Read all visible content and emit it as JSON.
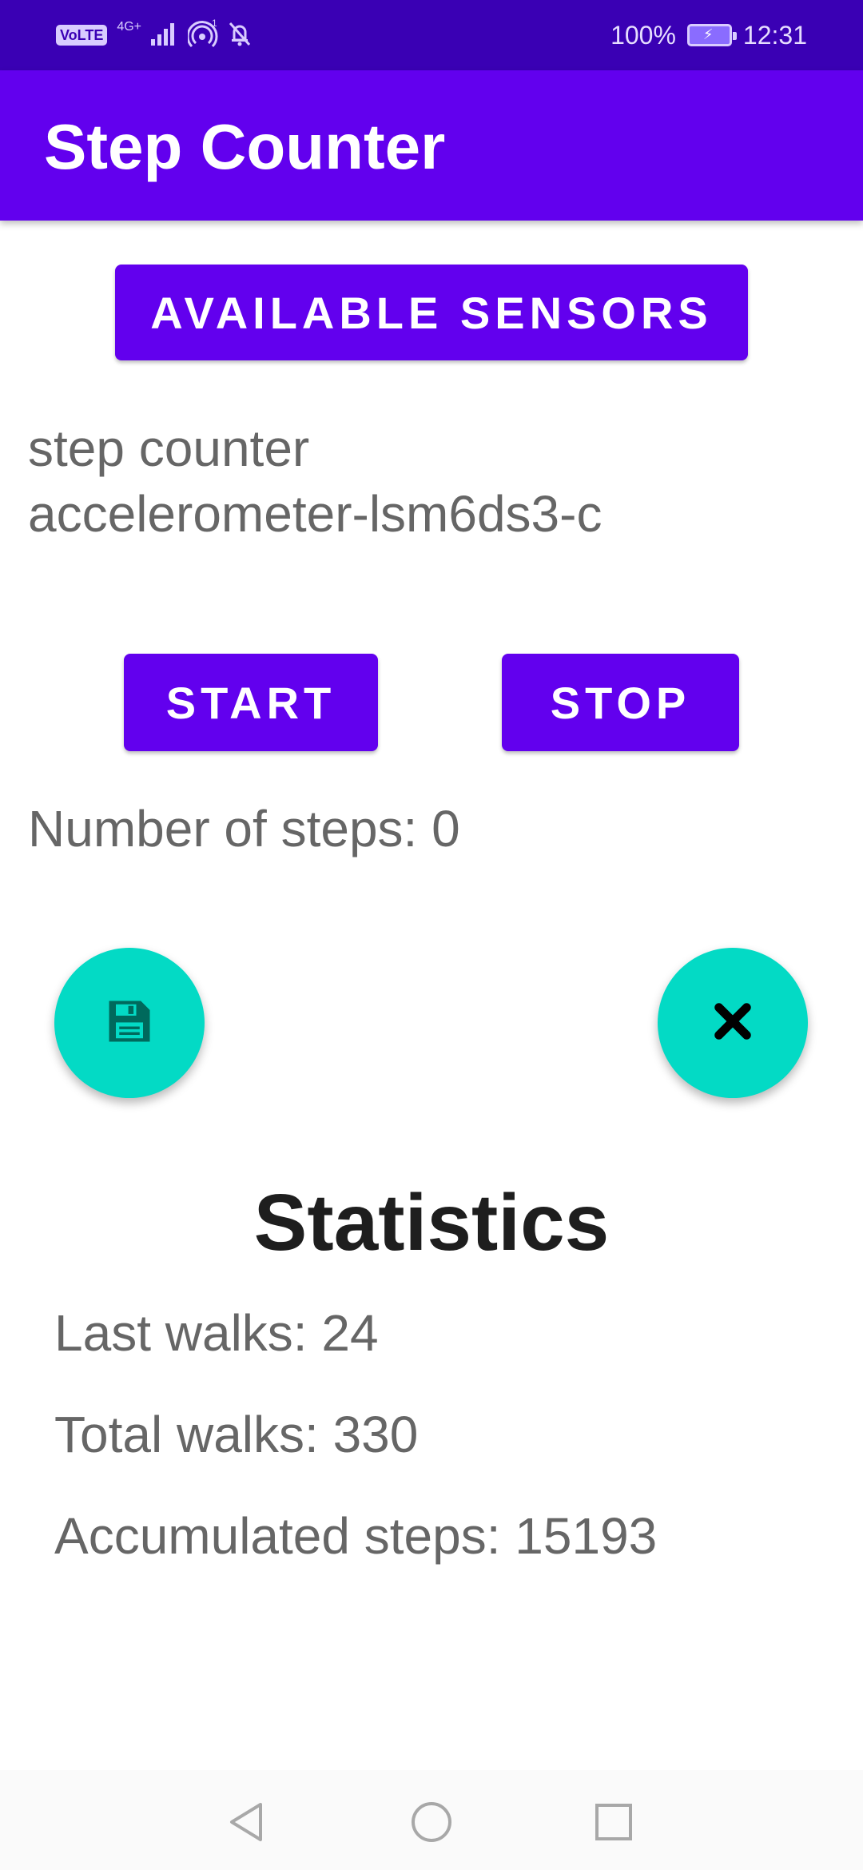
{
  "status_bar": {
    "volte": "VoLTE",
    "network": "4G+",
    "battery": "100%",
    "time": "12:31"
  },
  "app_bar": {
    "title": "Step Counter"
  },
  "buttons": {
    "available_sensors": "AVAILABLE SENSORS",
    "start": "START",
    "stop": "STOP"
  },
  "sensors": [
    "step counter",
    "accelerometer-lsm6ds3-c"
  ],
  "steps_text": "Number of steps: 0",
  "fabs": {
    "save_icon": "save-icon",
    "close_icon": "close-icon"
  },
  "statistics": {
    "title": "Statistics",
    "last_walks": "Last walks: 24",
    "total_walks": "Total walks: 330",
    "accumulated_steps": "Accumulated steps: 15193"
  },
  "colors": {
    "status_bar": "#3a00b4",
    "primary": "#6200ee",
    "fab": "#03dac5"
  }
}
